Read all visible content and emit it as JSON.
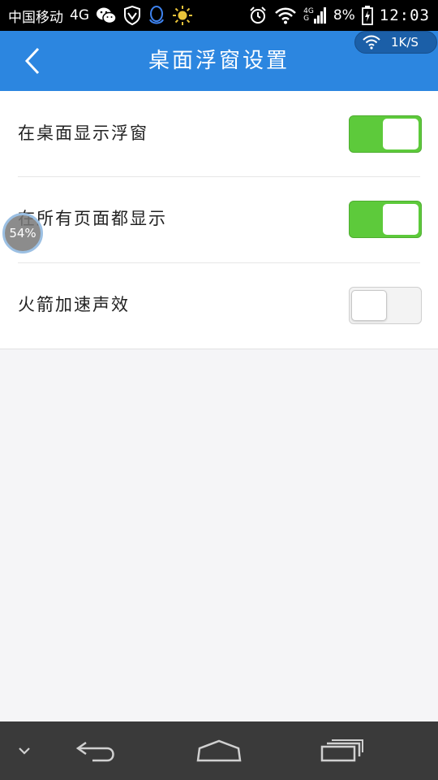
{
  "status_bar": {
    "carrier": "中国移动",
    "network": "4G",
    "signal_top": "4G",
    "signal_bottom": "G",
    "battery_percent": "8%",
    "time": "12:03",
    "icons": [
      "wechat-icon",
      "shield-icon",
      "qq-icon",
      "sun-icon",
      "alarm-icon",
      "wifi-icon",
      "signal-icon",
      "battery-charging-icon"
    ]
  },
  "speed_indicator": {
    "text": "1K/S"
  },
  "header": {
    "title": "桌面浮窗设置"
  },
  "settings": [
    {
      "label": "在桌面显示浮窗",
      "enabled": true
    },
    {
      "label": "在所有页面都显示",
      "enabled": true
    },
    {
      "label": "火箭加速声效",
      "enabled": false
    }
  ],
  "float_ball": {
    "text": "54%"
  },
  "nav": {
    "buttons": [
      "hide-nav-icon",
      "back-icon",
      "home-icon",
      "recents-icon"
    ]
  },
  "colors": {
    "header_bg": "#2c86e0",
    "toggle_on": "#5dca3b",
    "nav_bg": "#3a3a3a",
    "status_bg": "#000000"
  }
}
